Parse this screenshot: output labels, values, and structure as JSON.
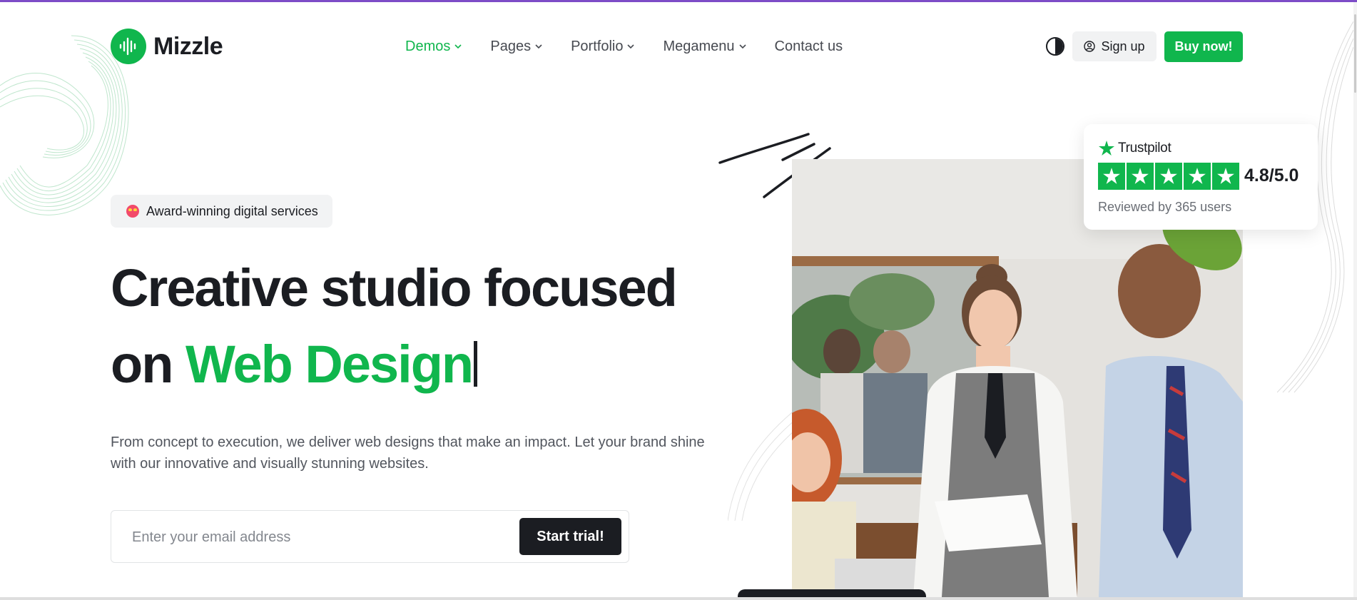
{
  "brand": {
    "name": "Mizzle",
    "accent_color": "#10b64d",
    "dark_color": "#1b1d22",
    "logo_icon": "soundwave-icon"
  },
  "nav": {
    "items": [
      {
        "label": "Demos",
        "has_dropdown": true,
        "active": true
      },
      {
        "label": "Pages",
        "has_dropdown": true,
        "active": false
      },
      {
        "label": "Portfolio",
        "has_dropdown": true,
        "active": false
      },
      {
        "label": "Megamenu",
        "has_dropdown": true,
        "active": false
      },
      {
        "label": "Contact us",
        "has_dropdown": false,
        "active": false
      }
    ]
  },
  "header": {
    "theme_toggle_icon": "contrast-icon",
    "signup_label": "Sign up",
    "signup_icon": "user-circle-icon",
    "buy_label": "Buy now!"
  },
  "hero": {
    "badge_emoji": "star-struck-emoji-icon",
    "badge_text": "Award-winning digital services",
    "headline_line1": "Creative studio focused",
    "headline_prefix": "on",
    "headline_highlight": "Web Design",
    "description": "From concept to execution, we deliver web designs that make an impact. Let your brand shine with our innovative and visually stunning websites.",
    "email_placeholder": "Enter your email address",
    "email_value": "",
    "cta_label": "Start trial!"
  },
  "trustpilot": {
    "brand": "Trustpilot",
    "stars": 5,
    "rating": "4.8/5.0",
    "reviews": "Reviewed by 365 users",
    "color": "#10b64d"
  }
}
